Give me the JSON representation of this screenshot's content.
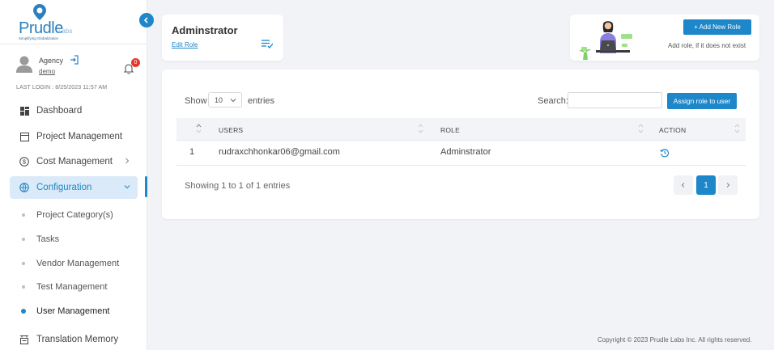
{
  "brand": {
    "name": "Prudle",
    "suffix": "Labs",
    "tagline": "Simplifying Globalization",
    "color": "#1d87c9"
  },
  "user": {
    "role": "Agency",
    "name": "demo",
    "notifications": "0",
    "last_login": "LAST LOGIN : 8/25/2023 11:57 AM"
  },
  "sidebar": {
    "items": [
      {
        "label": "Dashboard",
        "icon": "dashboard-icon"
      },
      {
        "label": "Project Management",
        "icon": "window-icon"
      },
      {
        "label": "Cost Management",
        "icon": "dollar-icon"
      },
      {
        "label": "Configuration",
        "icon": "config-icon"
      }
    ],
    "subitems": [
      {
        "label": "Project Category(s)"
      },
      {
        "label": "Tasks"
      },
      {
        "label": "Vendor Management"
      },
      {
        "label": "Test Management"
      },
      {
        "label": "User Management"
      }
    ],
    "bottom": {
      "label": "Translation Memory",
      "icon": "memory-icon"
    }
  },
  "header": {
    "title": "Adminstrator",
    "edit_label": "Edit Role"
  },
  "add_card": {
    "button_label": "+ Add New Role",
    "hint": "Add role, if it does not exist"
  },
  "table_controls": {
    "show": "Show",
    "page_size": "10",
    "entries": "entries",
    "search": "Search:",
    "search_value": "",
    "assign_label": "Assign role to user"
  },
  "table": {
    "columns": [
      "USERS",
      "ROLE",
      "ACTION"
    ],
    "rows": [
      {
        "index": "1",
        "user": "rudraxchhonkar06@gmail.com",
        "role": "Adminstrator"
      }
    ]
  },
  "pagination": {
    "summary": "Showing 1 to 1 of 1 entries",
    "current": "1"
  },
  "footer": {
    "copyright": "Copyright © 2023 Prudle Labs Inc. All rights reserved."
  }
}
